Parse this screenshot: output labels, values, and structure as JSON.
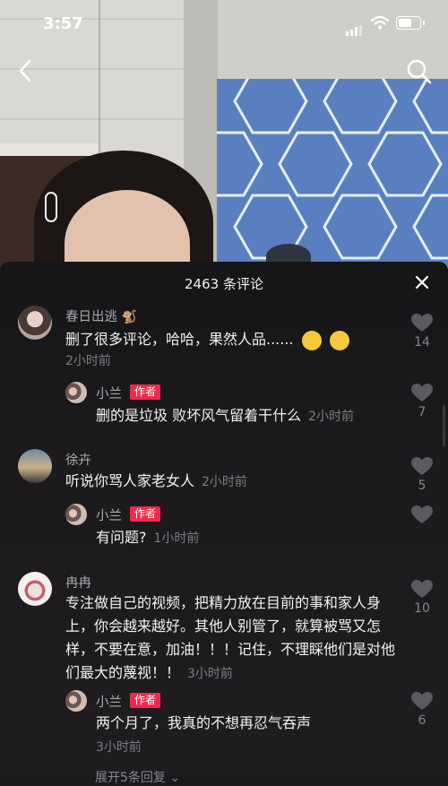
{
  "status_bar": {
    "time": "3:57"
  },
  "comments_panel": {
    "title": "2463 条评论",
    "comments": [
      {
        "name": "春日出逃",
        "text": "删了很多评论，哈哈，果然人品......",
        "time": "2小时前",
        "likes": "14",
        "reply": {
          "name": "小兰",
          "badge": "作者",
          "text": "删的是垃圾 败坏风气留着干什么",
          "time": "2小时前",
          "likes": "7"
        }
      },
      {
        "name": "徐卉",
        "text": "听说你骂人家老女人",
        "time": "2小时前",
        "likes": "5",
        "reply": {
          "name": "小兰",
          "badge": "作者",
          "text": "有问题?",
          "time": "1小时前",
          "likes": ""
        }
      },
      {
        "name": "冉冉",
        "text": "专注做自己的视频，把精力放在目前的事和家人身上，你会越来越好。其他人别管了，就算被骂又怎样，不要在意，加油！！！记住，不理睬他们是对他们最大的蔑视！！",
        "time": "3小时前",
        "likes": "10",
        "reply": {
          "name": "小兰",
          "badge": "作者",
          "text": "两个月了，我真的不想再忍气吞声",
          "time": "3小时前",
          "likes": "6"
        }
      }
    ],
    "more_replies": "展开5条回复"
  }
}
